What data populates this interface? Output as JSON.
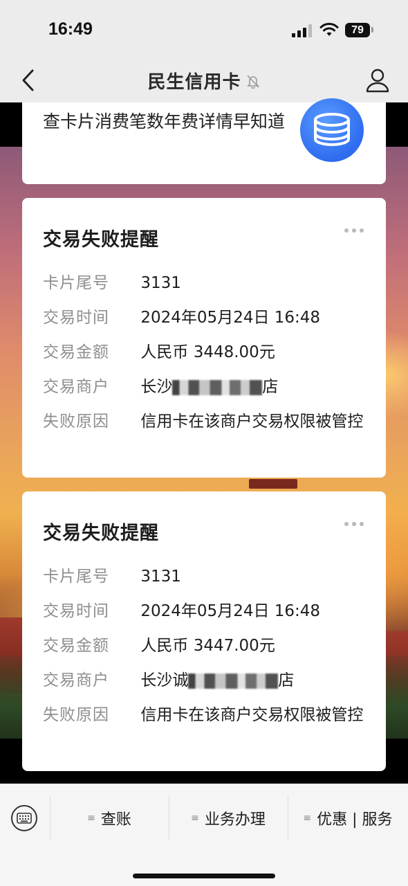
{
  "status_bar": {
    "time": "16:49",
    "battery": "79"
  },
  "nav": {
    "title": "民生信用卡",
    "back_icon": "chevron-left-icon",
    "mute_icon": "bell-slash-icon",
    "profile_icon": "person-icon"
  },
  "promo": {
    "text": "查卡片消费笔数年费详情早知道",
    "icon": "coin-stack-icon",
    "icon_color": "#3a78f2"
  },
  "alerts": [
    {
      "heading": "交易失败提醒",
      "rows": [
        {
          "label": "卡片尾号",
          "value": "3131"
        },
        {
          "label": "交易时间",
          "value": "2024年05月24日 16:48"
        },
        {
          "label": "交易金额",
          "value": "人民币 3448.00元"
        },
        {
          "label": "交易商户",
          "value_prefix": "长沙",
          "value_suffix": "店"
        },
        {
          "label": "失败原因",
          "value": "信用卡在该商户交易权限被管控"
        }
      ]
    },
    {
      "heading": "交易失败提醒",
      "rows": [
        {
          "label": "卡片尾号",
          "value": "3131"
        },
        {
          "label": "交易时间",
          "value": "2024年05月24日 16:48"
        },
        {
          "label": "交易金额",
          "value": "人民币 3447.00元"
        },
        {
          "label": "交易商户",
          "value_prefix": "长沙诚",
          "value_suffix": "店"
        },
        {
          "label": "失败原因",
          "value": "信用卡在该商户交易权限被管控"
        }
      ]
    }
  ],
  "tabbar": {
    "keyboard_icon": "keyboard-icon",
    "tabs": [
      {
        "label": "查账"
      },
      {
        "label": "业务办理"
      },
      {
        "label": "优惠 | 服务"
      }
    ]
  }
}
